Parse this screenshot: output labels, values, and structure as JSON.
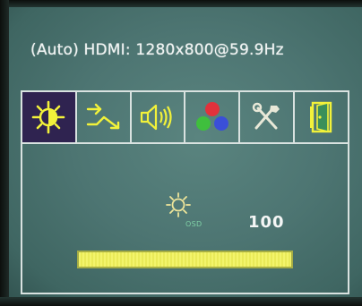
{
  "input_info": {
    "text": "(Auto) HDMI: 1280x800@59.9Hz"
  },
  "tabs": [
    {
      "icon": "brightness-icon",
      "active": true
    },
    {
      "icon": "signal-input-icon",
      "active": false
    },
    {
      "icon": "speaker-icon",
      "active": false
    },
    {
      "icon": "color-dots-icon",
      "active": false
    },
    {
      "icon": "tools-icon",
      "active": false
    },
    {
      "icon": "exit-door-icon",
      "active": false
    }
  ],
  "brightness": {
    "icon": "sun-icon",
    "sub_label": "OSD",
    "value": "100",
    "level_fraction": 1.0
  },
  "colors": {
    "active_tab": "#2f2350",
    "icon_yellow": "#f2f23a",
    "slider": "#f3f46b",
    "text": "#f1f4f3"
  }
}
